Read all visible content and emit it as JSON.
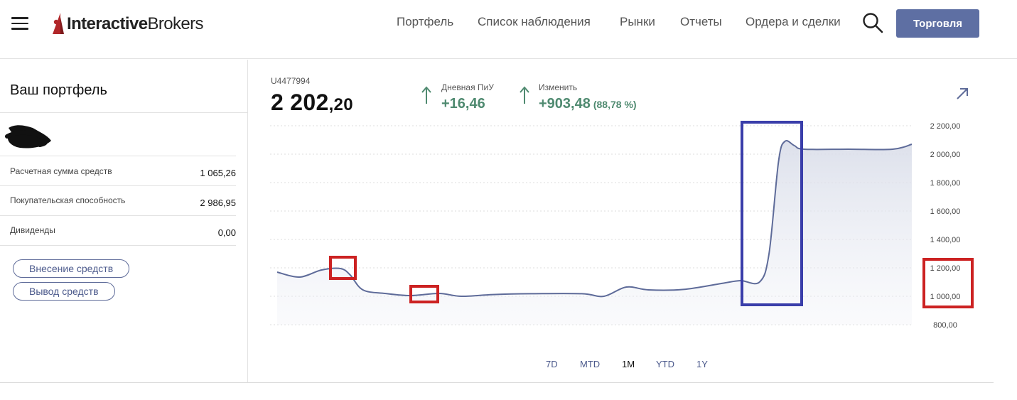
{
  "header": {
    "logo_bold": "Interactive",
    "logo_regular": "Brokers",
    "nav": [
      "Портфель",
      "Список наблюдения",
      "Рынки",
      "Отчеты",
      "Ордера и сделки"
    ],
    "trade_button": "Торговля",
    "accent_color": "#5e6fa3",
    "logo_color": "#b1272a"
  },
  "portfolio": {
    "title": "Ваш портфель",
    "rows": [
      {
        "label": "Расчетная сумма средств",
        "value": "1 065,26"
      },
      {
        "label": "Покупательская способность",
        "value": "2 986,95"
      },
      {
        "label": "Дивиденды",
        "value": "0,00"
      }
    ],
    "deposit_button": "Внесение средств",
    "withdraw_button": "Вывод средств"
  },
  "account": {
    "id": "U4477994",
    "balance_int": "2 202",
    "balance_frac": ",20",
    "daily_label": "Дневная ПиУ",
    "daily_value": "+16,46",
    "change_label": "Изменить",
    "change_value": "+903,48",
    "change_pct": "(88,78 %)",
    "positive_color": "#4f8a70"
  },
  "chart_data": {
    "type": "area",
    "ylim": [
      800,
      2200
    ],
    "yticks": [
      "2 200,00",
      "2 000,00",
      "1 800,00",
      "1 600,00",
      "1 400,00",
      "1 200,00",
      "1 000,00",
      "800,00"
    ],
    "grid": true,
    "line_color": "#5e6b99",
    "points": [
      [
        0,
        1170
      ],
      [
        0.035,
        1135
      ],
      [
        0.07,
        1185
      ],
      [
        0.1,
        1195
      ],
      [
        0.115,
        1150
      ],
      [
        0.135,
        1045
      ],
      [
        0.17,
        1020
      ],
      [
        0.21,
        1005
      ],
      [
        0.255,
        1020
      ],
      [
        0.29,
        1000
      ],
      [
        0.34,
        1012
      ],
      [
        0.4,
        1018
      ],
      [
        0.48,
        1018
      ],
      [
        0.515,
        1000
      ],
      [
        0.55,
        1065
      ],
      [
        0.585,
        1045
      ],
      [
        0.64,
        1048
      ],
      [
        0.7,
        1090
      ],
      [
        0.73,
        1110
      ],
      [
        0.76,
        1100
      ],
      [
        0.775,
        1300
      ],
      [
        0.79,
        1950
      ],
      [
        0.8,
        2090
      ],
      [
        0.815,
        2060
      ],
      [
        0.83,
        2035
      ],
      [
        0.9,
        2035
      ],
      [
        0.97,
        2035
      ],
      [
        1.0,
        2070
      ]
    ],
    "highlight_boxes": [
      {
        "color": "#cc2222"
      },
      {
        "color": "#cc2222"
      },
      {
        "color": "#3a3eaa"
      },
      {
        "color": "#cc2222"
      }
    ]
  },
  "ranges": [
    {
      "label": "7D",
      "active": false
    },
    {
      "label": "MTD",
      "active": false
    },
    {
      "label": "1M",
      "active": true
    },
    {
      "label": "YTD",
      "active": false
    },
    {
      "label": "1Y",
      "active": false
    }
  ]
}
